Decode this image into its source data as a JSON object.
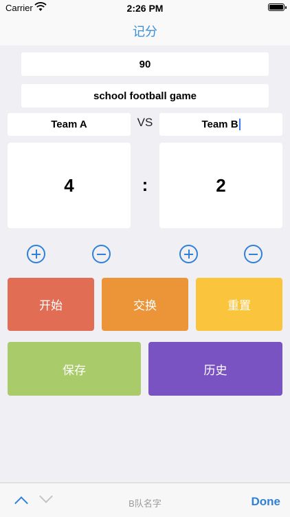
{
  "status": {
    "carrier": "Carrier",
    "time": "2:26 PM"
  },
  "nav": {
    "title": "记分"
  },
  "match": {
    "duration": "90",
    "name": "school football game",
    "team_a": "Team A",
    "vs": "VS",
    "team_b": "Team B"
  },
  "score": {
    "a": "4",
    "separator": ":",
    "b": "2"
  },
  "buttons": {
    "start": "开始",
    "swap": "交换",
    "reset": "重置",
    "save": "保存",
    "history": "历史"
  },
  "accessory": {
    "label": "B队名字",
    "done": "Done"
  },
  "colors": {
    "accent": "#2f80d9",
    "start": "#e26d55",
    "swap": "#ec9538",
    "reset": "#fbc43d",
    "save": "#a9cb6a",
    "history": "#7953c1"
  },
  "icons": [
    "wifi-icon",
    "battery-icon",
    "plus-circle-icon",
    "minus-circle-icon",
    "chevron-up-icon",
    "chevron-down-icon"
  ]
}
